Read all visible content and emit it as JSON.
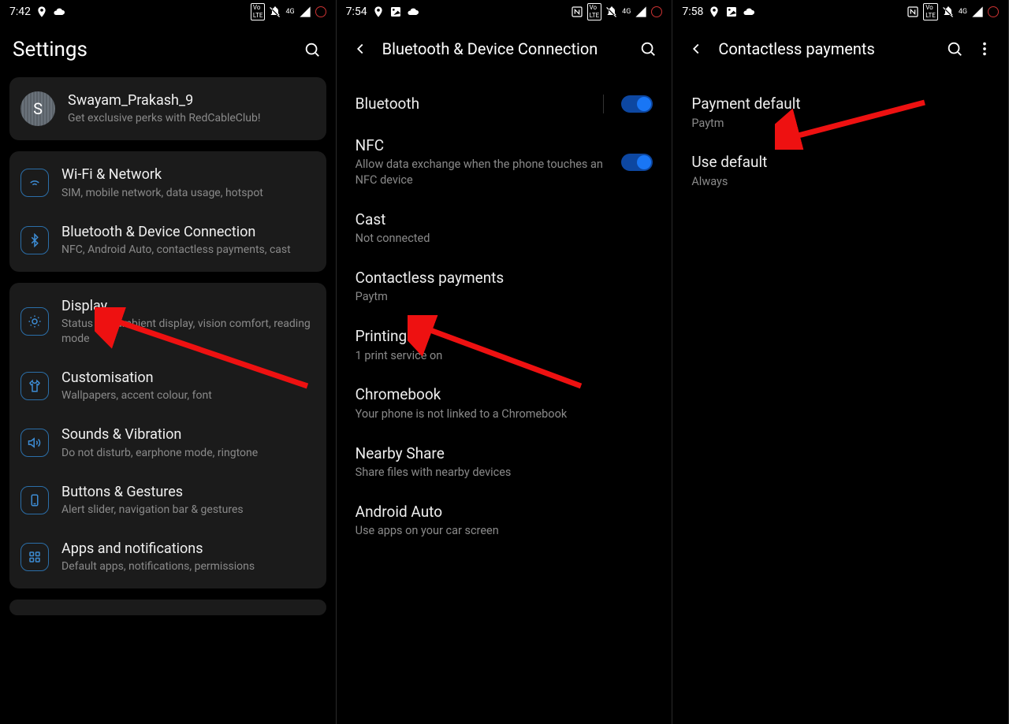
{
  "phones": [
    {
      "status": {
        "time": "7:42"
      },
      "header": {
        "title": "Settings"
      },
      "profile": {
        "letter": "S",
        "name": "Swayam_Prakash_9",
        "sub": "Get exclusive perks with RedCableClub!"
      },
      "groups": [
        [
          {
            "title": "Wi-Fi & Network",
            "sub": "SIM, mobile network, data usage, hotspot"
          },
          {
            "title": "Bluetooth & Device Connection",
            "sub": "NFC, Android Auto, contactless payments, cast"
          }
        ],
        [
          {
            "title": "Display",
            "sub": "Status bar, ambient display, vision comfort, reading mode"
          },
          {
            "title": "Customisation",
            "sub": "Wallpapers, accent colour, font"
          },
          {
            "title": "Sounds & Vibration",
            "sub": "Do not disturb, earphone mode, ringtone"
          },
          {
            "title": "Buttons & Gestures",
            "sub": "Alert slider, navigation bar & gestures"
          },
          {
            "title": "Apps and notifications",
            "sub": "Default apps, notifications, permissions"
          }
        ]
      ]
    },
    {
      "status": {
        "time": "7:54"
      },
      "header": {
        "title": "Bluetooth & Device Connection"
      },
      "items": [
        {
          "title": "Bluetooth",
          "sub": "",
          "toggle": true,
          "sep": true
        },
        {
          "title": "NFC",
          "sub": "Allow data exchange when the phone touches an NFC device",
          "toggle": true
        },
        {
          "title": "Cast",
          "sub": "Not connected"
        },
        {
          "title": "Contactless payments",
          "sub": "Paytm"
        },
        {
          "title": "Printing",
          "sub": "1 print service on"
        },
        {
          "title": "Chromebook",
          "sub": "Your phone is not linked to a Chromebook"
        },
        {
          "title": "Nearby Share",
          "sub": "Share files with nearby devices"
        },
        {
          "title": "Android Auto",
          "sub": "Use apps on your car screen"
        }
      ]
    },
    {
      "status": {
        "time": "7:58"
      },
      "header": {
        "title": "Contactless payments"
      },
      "items": [
        {
          "title": "Payment default",
          "sub": "Paytm"
        },
        {
          "title": "Use default",
          "sub": "Always"
        }
      ]
    }
  ]
}
